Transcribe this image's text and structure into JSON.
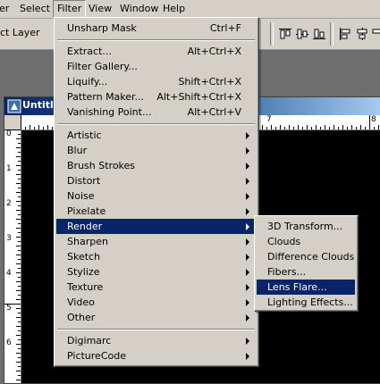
{
  "menubar": {
    "items": [
      {
        "label": "er"
      },
      {
        "label": "Select"
      },
      {
        "label": "Filter"
      },
      {
        "label": "View"
      },
      {
        "label": "Window"
      },
      {
        "label": "Help"
      }
    ]
  },
  "options_bar": {
    "label": "ct Layer"
  },
  "document": {
    "title": "Untitle",
    "top_ruler_numbers": [
      "7",
      "8"
    ],
    "left_ruler_numbers": [
      "0",
      "1",
      "2",
      "3",
      "4",
      "5",
      "6"
    ]
  },
  "filter_menu": {
    "items": [
      {
        "label": "Unsharp Mask",
        "shortcut": "Ctrl+F"
      },
      {
        "label": "Extract...",
        "shortcut": "Alt+Ctrl+X"
      },
      {
        "label": "Filter Gallery...",
        "shortcut": ""
      },
      {
        "label": "Liquify...",
        "shortcut": "Shift+Ctrl+X"
      },
      {
        "label": "Pattern Maker...",
        "shortcut": "Alt+Shift+Ctrl+X"
      },
      {
        "label": "Vanishing Point...",
        "shortcut": "Alt+Ctrl+V"
      },
      {
        "label": "Artistic"
      },
      {
        "label": "Blur"
      },
      {
        "label": "Brush Strokes"
      },
      {
        "label": "Distort"
      },
      {
        "label": "Noise"
      },
      {
        "label": "Pixelate"
      },
      {
        "label": "Render"
      },
      {
        "label": "Sharpen"
      },
      {
        "label": "Sketch"
      },
      {
        "label": "Stylize"
      },
      {
        "label": "Texture"
      },
      {
        "label": "Video"
      },
      {
        "label": "Other"
      },
      {
        "label": "Digimarc"
      },
      {
        "label": "PictureCode"
      }
    ]
  },
  "render_menu": {
    "items": [
      {
        "label": "3D Transform..."
      },
      {
        "label": "Clouds"
      },
      {
        "label": "Difference Clouds"
      },
      {
        "label": "Fibers..."
      },
      {
        "label": "Lens Flare..."
      },
      {
        "label": "Lighting Effects..."
      }
    ]
  },
  "colors": {
    "menu_bg": "#d4d0c8",
    "highlight": "#0a246a",
    "canvas": "#000000"
  }
}
